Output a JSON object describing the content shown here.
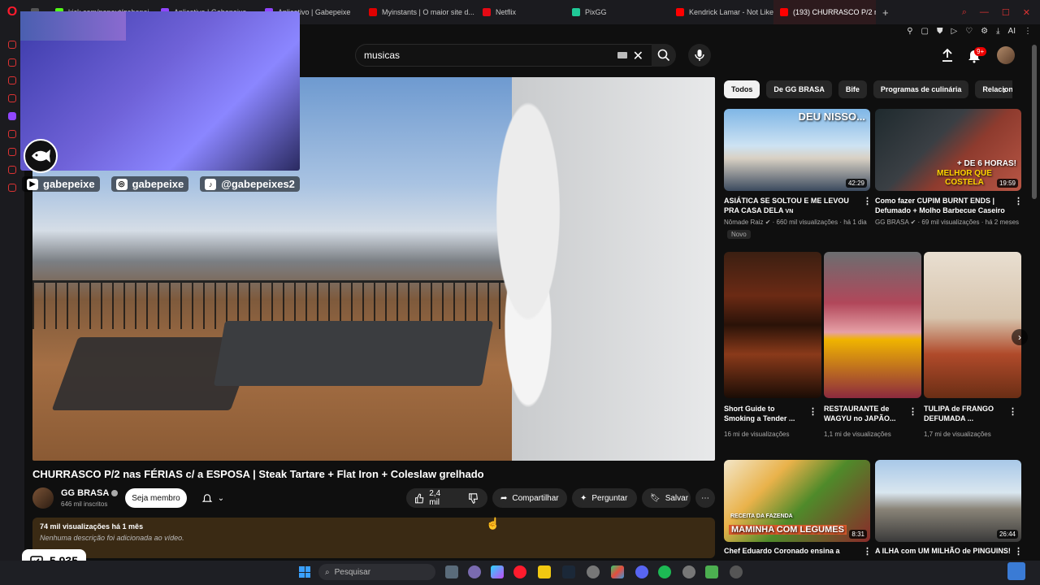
{
  "browser": {
    "tabs": [
      {
        "label": "kick.com/popout/gabepei...",
        "color": "#53fc18"
      },
      {
        "label": "Aplicativo | Gabepeixe",
        "color": "#9146ff"
      },
      {
        "label": "Aplicativo | Gabepeixe",
        "color": "#9146ff"
      },
      {
        "label": "Myinstants | O maior site d...",
        "color": "#e00000"
      },
      {
        "label": "Netflix",
        "color": "#e50914"
      },
      {
        "label": "PixGG",
        "color": "#20c997"
      },
      {
        "label": "Kendrick Lamar - Not Like...",
        "color": "#ff0000"
      },
      {
        "label": "(193) CHURRASCO P/2 na...",
        "color": "#ff0000"
      }
    ],
    "new_tab": "+",
    "ai_label": "AI"
  },
  "youtube": {
    "search_value": "musicas",
    "notif_count": "9+",
    "video": {
      "title": "CHURRASCO P/2 nas FÉRIAS c/ a ESPOSA | Steak Tartare + Flat Iron + Coleslaw grelhado",
      "channel": "GG BRASA",
      "subscribers": "646 mil inscritos",
      "member_label": "Seja membro",
      "likes": "2,4 mil",
      "share_label": "Compartilhar",
      "ask_label": "Perguntar",
      "save_label": "Salvar",
      "views": "74 mil visualizações  há 1 mês",
      "description": "Nenhuma descrição foi adicionada ao vídeo."
    },
    "chips": [
      "Todos",
      "De GG BRASA",
      "Bife",
      "Programas de culinária",
      "Relacionado"
    ],
    "recs": [
      {
        "title": "ASIÁTICA SE SOLTOU E ME LEVOU PRA CASA DELA",
        "tag": "VN",
        "channel": "Nômade Raiz",
        "meta": "660 mil visualizações · há 1 dia",
        "badge": "Novo",
        "duration": "42:29",
        "overlay": "DEU NISSO..."
      },
      {
        "title": "Como fazer CUPIM BURNT ENDS | Defumado + Molho Barbecue Caseiro",
        "channel": "GG BRASA",
        "meta": "69 mil visualizações · há 2 meses",
        "duration": "19:59",
        "overlay1": "+ DE 6 HORAS!",
        "overlay2": "MELHOR QUE COSTELA"
      }
    ],
    "shorts": [
      {
        "title": "Short Guide to Smoking a Tender ...",
        "views": "16 mi de visualizações"
      },
      {
        "title": "RESTAURANTE de WAGYU no JAPÃO...",
        "views": "1,1 mi de visualizações"
      },
      {
        "title": "TULIPA de FRANGO DEFUMADA ...",
        "views": "1,7 mi de visualizações"
      }
    ],
    "recs_bottom": [
      {
        "title": "Chef Eduardo Coronado ensina a",
        "duration": "8:31",
        "overlay_top": "RECEITA DA FAZENDA",
        "overlay": "MAMINHA COM LEGUMES"
      },
      {
        "title": "A ILHA com UM MILHÃO de PINGUINS!",
        "duration": "26:44"
      }
    ]
  },
  "stream": {
    "socials": [
      {
        "icon": "youtube-icon",
        "handle": "gabepeixe"
      },
      {
        "icon": "instagram-icon",
        "handle": "gabepeixe"
      },
      {
        "icon": "tiktok-icon",
        "handle": "@gabepeixes2"
      }
    ],
    "points": "5.935"
  },
  "taskbar": {
    "search_placeholder": "Pesquisar"
  },
  "colors": {
    "accent": "#ff0000",
    "bg": "#0f0f0f",
    "chip_active": "#f1f1f1"
  }
}
